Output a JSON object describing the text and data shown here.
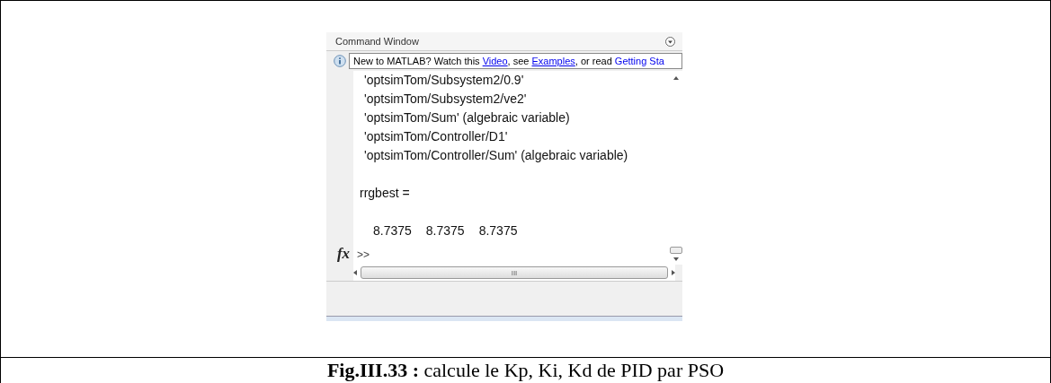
{
  "command_window": {
    "title": "Command Window",
    "info_bar": [
      {
        "kind": "plain",
        "text": "New to MATLAB? Watch this "
      },
      {
        "kind": "link",
        "text": "Video"
      },
      {
        "kind": "plain",
        "text": ", see "
      },
      {
        "kind": "link",
        "text": "Examples"
      },
      {
        "kind": "plain",
        "text": ", or read "
      },
      {
        "kind": "link",
        "text": "Getting Sta"
      }
    ],
    "output": [
      {
        "kind": "list",
        "lines": [
          "'optsimTom/Subsystem2/0.9'",
          "'optsimTom/Subsystem2/ve2'",
          "'optsimTom/Sum' (algebraic variable)",
          "'optsimTom/Controller/D1'",
          "'optsimTom/Controller/Sum' (algebraic variable)"
        ]
      },
      {
        "kind": "variable",
        "text": "rrgbest ="
      },
      {
        "kind": "values",
        "items": [
          "8.7375",
          "8.7375",
          "8.7375"
        ]
      }
    ],
    "fx_button": "fx",
    "prompt": ">>",
    "hscroll_grip": "III"
  },
  "caption": "**Fig.III.33 :** calcule le Kp, Ki, Kd de PID par PSO"
}
